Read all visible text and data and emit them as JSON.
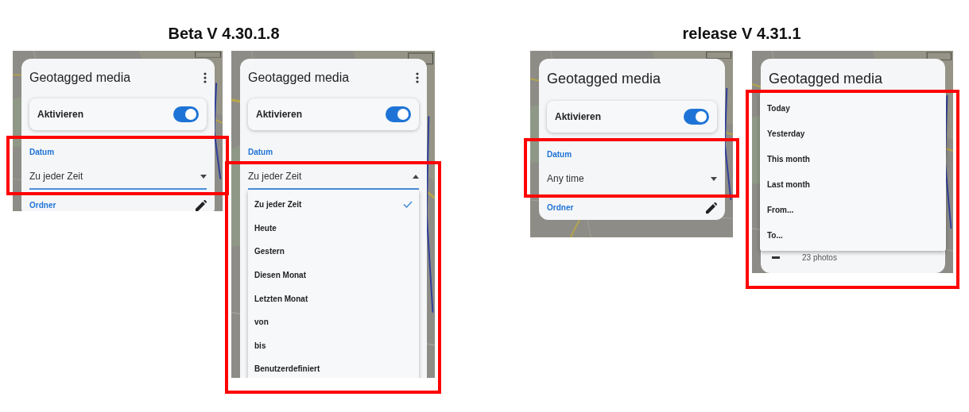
{
  "sections": [
    {
      "heading": "Beta V 4.30.1.8",
      "screens": [
        {
          "title": "Geotagged media",
          "more_menu": true,
          "highlighted": true,
          "toggle": {
            "label": "Aktivieren",
            "on": true
          },
          "date": {
            "label": "Datum",
            "value": "Zu jeder Zeit",
            "focused": true,
            "expanded": false
          },
          "folder": {
            "label": "Ordner"
          }
        },
        {
          "title": "Geotagged media",
          "more_menu": true,
          "highlighted": true,
          "toggle": {
            "label": "Aktivieren",
            "on": true
          },
          "date": {
            "label": "Datum",
            "value": "Zu jeder Zeit",
            "focused": true,
            "expanded": true
          },
          "menu": [
            {
              "label": "Zu jeder Zeit",
              "selected": true
            },
            {
              "label": "Heute",
              "selected": false
            },
            {
              "label": "Gestern",
              "selected": false
            },
            {
              "label": "Diesen Monat",
              "selected": false
            },
            {
              "label": "Letzten Monat",
              "selected": false
            },
            {
              "label": "von",
              "selected": false
            },
            {
              "label": "bis",
              "selected": false
            },
            {
              "label": "Benutzerdefiniert",
              "selected": false
            }
          ]
        }
      ]
    },
    {
      "heading": "release V 4.31.1",
      "screens": [
        {
          "title": "Geotagged media",
          "more_menu": false,
          "highlighted": true,
          "toggle": {
            "label": "Aktivieren",
            "on": true
          },
          "date": {
            "label": "Datum",
            "value": "Any time",
            "focused": false,
            "expanded": false
          },
          "folder": {
            "label": "Ordner"
          }
        },
        {
          "title": "Geotagged media",
          "more_menu": false,
          "highlighted": true,
          "menu": [
            {
              "label": "Today",
              "selected": false
            },
            {
              "label": "Yesterday",
              "selected": false
            },
            {
              "label": "This month",
              "selected": false
            },
            {
              "label": "Last month",
              "selected": false
            },
            {
              "label": "From...",
              "selected": false
            },
            {
              "label": "To...",
              "selected": false
            }
          ],
          "items": [
            {
              "caption": "23 photos"
            }
          ]
        }
      ]
    }
  ]
}
